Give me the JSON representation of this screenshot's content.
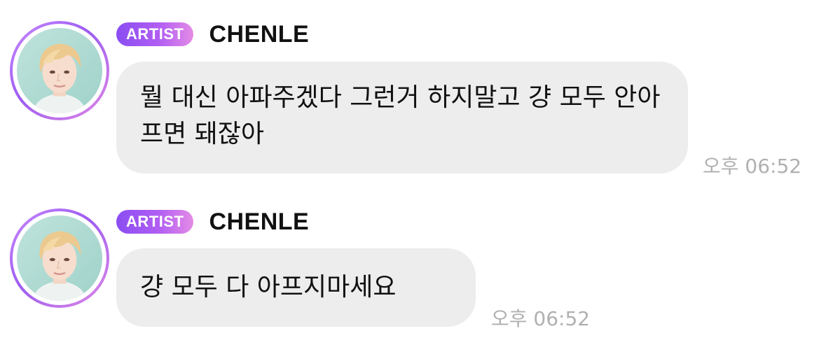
{
  "messages": [
    {
      "badge": "ARTIST",
      "sender": "CHENLE",
      "text": "뭘 대신 아파주겠다 그런거 하지말고 걍 모두 안아프면 돼잖아",
      "time": "오후 06:52"
    },
    {
      "badge": "ARTIST",
      "sender": "CHENLE",
      "text": "걍 모두 다 아프지마세요",
      "time": "오후 06:52"
    }
  ],
  "colors": {
    "badge_gradient_start": "#8a4df2",
    "badge_gradient_end": "#e48be6",
    "bubble_background": "#ededed",
    "timestamp": "#b0b0b0"
  },
  "icons": {
    "avatar": "artist-profile-photo"
  }
}
